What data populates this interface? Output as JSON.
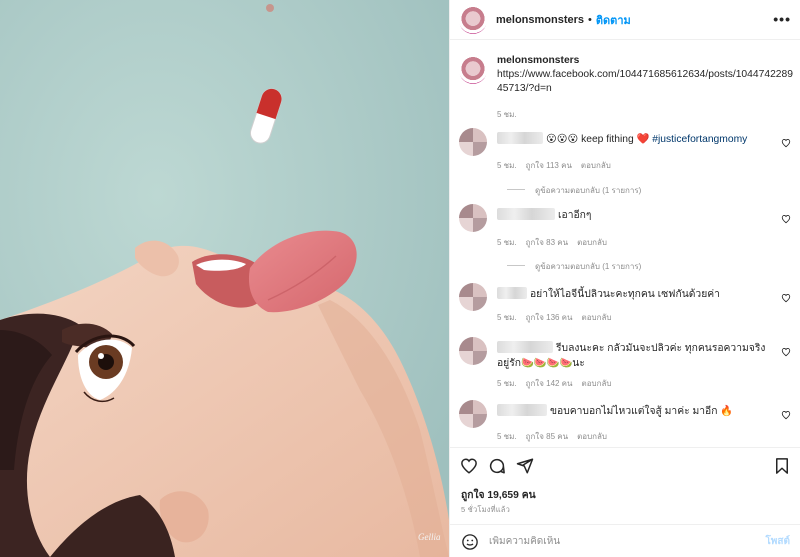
{
  "post": {
    "username": "melonsmonsters",
    "follow_label": "ติดตาม",
    "more_icon": "more-horizontal-icon",
    "caption": {
      "username": "melonsmonsters",
      "link": "https://www.facebook.com/104471685612634/posts/104474228945713/?d=n",
      "time": "5 ชม."
    }
  },
  "comments": [
    {
      "text": "😮😮😮 keep fithing ❤️",
      "hashtag": "#justicefortangmomy",
      "time": "5 ชม.",
      "likes": "ถูกใจ 113 คน",
      "reply": "ตอบกลับ",
      "view_replies": "ดูข้อความตอบกลับ (1 รายการ)"
    },
    {
      "text": "เอาอีกๆ",
      "time": "5 ชม.",
      "likes": "ถูกใจ 83 คน",
      "reply": "ตอบกลับ",
      "view_replies": "ดูข้อความตอบกลับ (1 รายการ)"
    },
    {
      "text": "อย่าให้ไอจีนี้ปลิวนะคะทุกคน เซฟกันด้วยค่า",
      "time": "5 ชม.",
      "likes": "ถูกใจ 136 คน",
      "reply": "ตอบกลับ"
    },
    {
      "text": "รีบลงนะคะ กลัวมันจะปลิวค่ะ ทุกคนรอความจริงอยู่รัก🍉🍉🍉🍉นะ",
      "time": "5 ชม.",
      "likes": "ถูกใจ 142 คน",
      "reply": "ตอบกลับ"
    },
    {
      "text": "ขอบคาบอกไม่ไหวแต่ใจสู้ มาค่ะ มาอีก 🔥",
      "time": "5 ชม.",
      "likes": "ถูกใจ 85 คน",
      "reply": "ตอบกลับ"
    }
  ],
  "actions": {
    "likes_count": "ถูกใจ 19,659 คน",
    "time_ago": "5 ชั่วโมงที่แล้ว",
    "comment_placeholder": "เพิ่มความคิดเห็น",
    "post_label": "โพสต์"
  },
  "artwork": {
    "signature": "Gellia",
    "background_color": "#a9c7c4",
    "pill_colors": [
      "#c9302c",
      "#ffffff"
    ]
  }
}
